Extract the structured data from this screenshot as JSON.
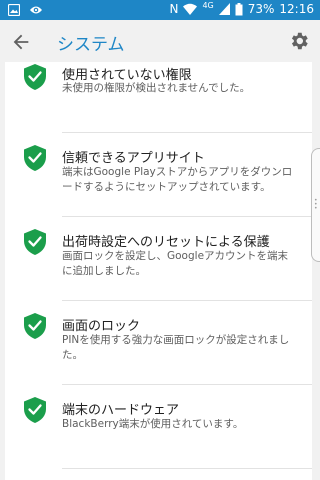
{
  "status_bar": {
    "time": "12:16",
    "battery": "73%",
    "network": "4G",
    "icons": [
      "image-icon",
      "eye-icon",
      "nfc-icon",
      "wifi-icon",
      "signal-icon",
      "battery-icon"
    ]
  },
  "app_bar": {
    "title": "システム",
    "back_icon": "arrow-back-icon",
    "settings_icon": "gear-icon",
    "accent_color": "#1e86c6"
  },
  "items": [
    {
      "title": "使用されていない権限",
      "description": "未使用の権限が検出されませんでした。"
    },
    {
      "title": "信頼できるアプリサイト",
      "description": "端末はGoogle Playストアからアプリをダウンロードするようにセットアップされています。"
    },
    {
      "title": "出荷時設定へのリセットによる保護",
      "description": "画面ロックを設定し、Googleアカウントを端末に追加しました。"
    },
    {
      "title": "画面のロック",
      "description": "PINを使用する強力な画面ロックが設定されました。"
    },
    {
      "title": "端末のハードウェア",
      "description": "BlackBerry端末が使用されています。"
    }
  ],
  "status_icon": "shield-check-icon",
  "status_color": "#1b9e4b"
}
